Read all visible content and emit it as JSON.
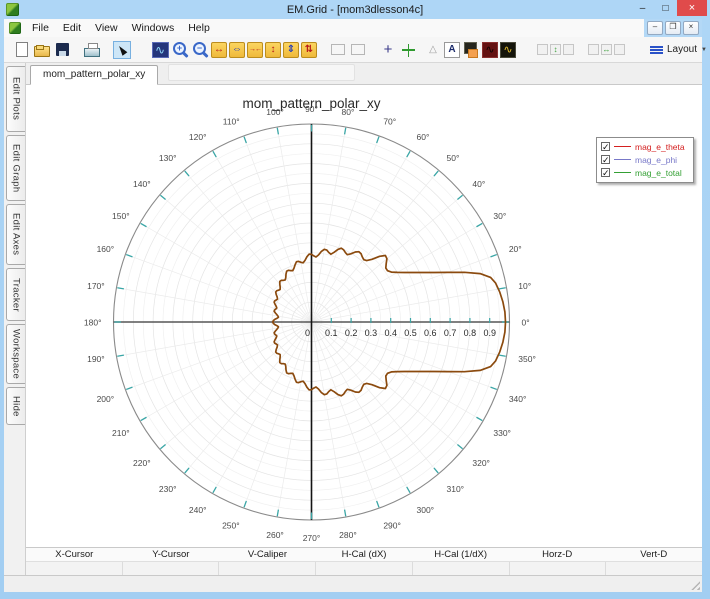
{
  "window": {
    "title": "EM.Grid - [mom3dlesson4c]"
  },
  "icons": {
    "minimize": "–",
    "maximize": "□",
    "close": "×",
    "mdi_minimize": "–",
    "mdi_restore": "❐",
    "mdi_close": "×",
    "check": "✓",
    "expand-x": "↔",
    "pan-x": "⇔",
    "compress-x": "→←",
    "expand-y": "↕",
    "pan-y": "⇕",
    "compress-y": "⇅",
    "add-marker": "+",
    "marker-triangle": "△",
    "add-text": "A",
    "wave": "∿",
    "layout-caret": "▼"
  },
  "menu": {
    "items": [
      "File",
      "Edit",
      "View",
      "Windows",
      "Help"
    ]
  },
  "toolbar": {
    "layout_label": "Layout",
    "icons": [
      "new-document",
      "open-file",
      "save",
      "gap",
      "print",
      "gap",
      "select-cursor",
      "gap-lg",
      "plot-properties",
      "zoom-in",
      "zoom-out",
      "expand-x",
      "pan-x",
      "compress-x",
      "expand-y",
      "pan-y",
      "compress-y",
      "gap",
      "region-select",
      "region-select-b",
      "gap",
      "add-marker",
      "axes-tool",
      "gap-sm",
      "marker-triangle",
      "add-text",
      "copy-graph",
      "graph-red",
      "graph-gold",
      "gap-lg",
      "group-valign",
      "gap",
      "group-halign",
      "gap-lg",
      "layout-menu"
    ]
  },
  "sidebar": {
    "tabs": [
      "Edit Plots",
      "Edit Graph",
      "Edit Axes",
      "Tracker",
      "Workspace",
      "Hide"
    ]
  },
  "tabs": {
    "active": "mom_pattern_polar_xy"
  },
  "chart_data": {
    "type": "polar-line",
    "title": "mom_pattern_polar_xy",
    "r_max": 1.0,
    "grid": {
      "radial_step_deg": 10,
      "ring_step": 0.05,
      "on": true
    },
    "angle_labels": [
      "0°",
      "10°",
      "20°",
      "30°",
      "40°",
      "50°",
      "60°",
      "70°",
      "80°",
      "90°",
      "100°",
      "110°",
      "120°",
      "130°",
      "140°",
      "150°",
      "160°",
      "170°",
      "180°",
      "190°",
      "200°",
      "210°",
      "220°",
      "230°",
      "240°",
      "250°",
      "260°",
      "270°",
      "280°",
      "290°",
      "300°",
      "310°",
      "320°",
      "330°",
      "340°",
      "350°"
    ],
    "radial_labels": [
      "0",
      "0.1",
      "0.2",
      "0.3",
      "0.4",
      "0.5",
      "0.6",
      "0.7",
      "0.8",
      "0.9"
    ],
    "legend": {
      "position": "top-right",
      "entries": [
        {
          "label": "mag_e_theta",
          "color": "#D42020",
          "checked": true
        },
        {
          "label": "mag_e_phi",
          "color": "#7878C8",
          "checked": true
        },
        {
          "label": "mag_e_total",
          "color": "#34A034",
          "checked": true
        }
      ]
    },
    "series": [
      {
        "name": "visible_pattern_curve",
        "color": "#8B4A0E",
        "symmetric_about_0_180_axis": true,
        "points_deg_r": [
          [
            0,
            0.98
          ],
          [
            3,
            0.978
          ],
          [
            6,
            0.972
          ],
          [
            9,
            0.963
          ],
          [
            12,
            0.95
          ],
          [
            14,
            0.932
          ],
          [
            16,
            0.886
          ],
          [
            18,
            0.812
          ],
          [
            20,
            0.732
          ],
          [
            22,
            0.668
          ],
          [
            24,
            0.615
          ],
          [
            26,
            0.57
          ],
          [
            28,
            0.532
          ],
          [
            30,
            0.501
          ],
          [
            32,
            0.476
          ],
          [
            34,
            0.463
          ],
          [
            36,
            0.464
          ],
          [
            38,
            0.479
          ],
          [
            40,
            0.497
          ],
          [
            42,
            0.502
          ],
          [
            44,
            0.478
          ],
          [
            46,
            0.44
          ],
          [
            48,
            0.417
          ],
          [
            50,
            0.411
          ],
          [
            52,
            0.417
          ],
          [
            54,
            0.426
          ],
          [
            56,
            0.428
          ],
          [
            58,
            0.417
          ],
          [
            60,
            0.398
          ],
          [
            62,
            0.385
          ],
          [
            64,
            0.39
          ],
          [
            66,
            0.399
          ],
          [
            68,
            0.402
          ],
          [
            70,
            0.39
          ],
          [
            72,
            0.37
          ],
          [
            74,
            0.356
          ],
          [
            76,
            0.362
          ],
          [
            78,
            0.371
          ],
          [
            80,
            0.373
          ],
          [
            82,
            0.36
          ],
          [
            84,
            0.341
          ],
          [
            86,
            0.329
          ],
          [
            88,
            0.334
          ],
          [
            90,
            0.342
          ],
          [
            92,
            0.343
          ],
          [
            94,
            0.33
          ],
          [
            96,
            0.313
          ],
          [
            98,
            0.302
          ],
          [
            100,
            0.306
          ],
          [
            102,
            0.313
          ],
          [
            104,
            0.314
          ],
          [
            106,
            0.301
          ],
          [
            108,
            0.286
          ],
          [
            110,
            0.276
          ],
          [
            112,
            0.28
          ],
          [
            114,
            0.286
          ],
          [
            116,
            0.286
          ],
          [
            118,
            0.274
          ],
          [
            120,
            0.26
          ],
          [
            122,
            0.251
          ],
          [
            124,
            0.254
          ],
          [
            126,
            0.26
          ],
          [
            128,
            0.26
          ],
          [
            130,
            0.249
          ],
          [
            132,
            0.236
          ],
          [
            134,
            0.228
          ],
          [
            136,
            0.231
          ],
          [
            138,
            0.236
          ],
          [
            140,
            0.236
          ],
          [
            142,
            0.226
          ],
          [
            144,
            0.214
          ],
          [
            146,
            0.207
          ],
          [
            148,
            0.21
          ],
          [
            150,
            0.214
          ],
          [
            152,
            0.214
          ],
          [
            154,
            0.205
          ],
          [
            156,
            0.195
          ],
          [
            158,
            0.189
          ],
          [
            160,
            0.192
          ],
          [
            162,
            0.196
          ],
          [
            164,
            0.196
          ],
          [
            166,
            0.188
          ],
          [
            168,
            0.179
          ],
          [
            170,
            0.172
          ],
          [
            172,
            0.169
          ],
          [
            174,
            0.176
          ],
          [
            176,
            0.186
          ],
          [
            178,
            0.193
          ],
          [
            180,
            0.196
          ]
        ]
      }
    ]
  },
  "calipers": {
    "labels": [
      "X-Cursor",
      "Y-Cursor",
      "V-Caliper",
      "H-Cal (dX)",
      "H-Cal (1/dX)",
      "Horz-D",
      "Vert-D"
    ],
    "values": [
      "",
      "",
      "",
      "",
      "",
      "",
      ""
    ]
  },
  "colors": {
    "titlebar": "#A9D4F5",
    "close_button": "#E04B4B",
    "curve": "#8B4A0E",
    "tick_teal": "#3AA6A6",
    "grid_line": "#E9E9E9",
    "outer_circle": "#8A8A8A",
    "yellow_button": "#F2C23E"
  }
}
